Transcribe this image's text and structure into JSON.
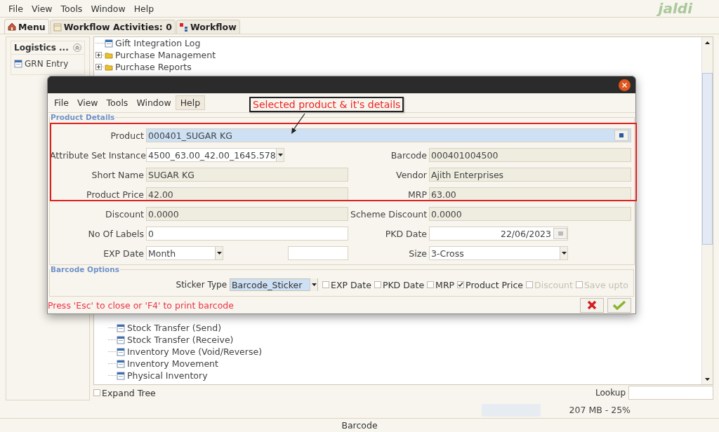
{
  "menu_bar": {
    "items": [
      {
        "label": "File"
      },
      {
        "label": "View"
      },
      {
        "label": "Tools"
      },
      {
        "label": "Window"
      },
      {
        "label": "Help"
      }
    ],
    "logo": "jaldi"
  },
  "tabs": [
    {
      "label": "Menu",
      "kind": "home",
      "selected": true
    },
    {
      "label": "Workflow Activities: 0",
      "kind": "activities",
      "selected": false
    },
    {
      "label": "Workflow",
      "kind": "workflow",
      "selected": false
    }
  ],
  "sidebar": {
    "title": "Logistics ...",
    "items": [
      {
        "label": "GRN Entry"
      }
    ]
  },
  "tree": {
    "top_items": [
      {
        "label": "Gift Integration Log",
        "kind": "leaf"
      },
      {
        "label": "Purchase Management",
        "kind": "folder"
      },
      {
        "label": "Purchase Reports",
        "kind": "folder"
      }
    ],
    "bottom_items": [
      {
        "label": "Stock Transfer (Send)"
      },
      {
        "label": "Stock Transfer (Receive)"
      },
      {
        "label": "Inventory Move (Void/Reverse)"
      },
      {
        "label": "Inventory Movement"
      },
      {
        "label": "Physical Inventory"
      }
    ]
  },
  "expand_tree": {
    "label": "Expand Tree",
    "checked": false
  },
  "lookup": {
    "label": "Lookup"
  },
  "memory": {
    "reading": "207 MB - 25%"
  },
  "status_bar": "Barcode",
  "dialog": {
    "menu": [
      {
        "label": "File",
        "selected": false
      },
      {
        "label": "View",
        "selected": false
      },
      {
        "label": "Tools",
        "selected": false
      },
      {
        "label": "Window",
        "selected": false
      },
      {
        "label": "Help",
        "selected": true
      }
    ],
    "annotation": "Selected product & it's details",
    "product_details": {
      "legend": "Product Details",
      "rows": [
        {
          "label": "Product",
          "field": {
            "kind": "lookup",
            "value": "000401_SUGAR KG",
            "focused": true
          }
        },
        {
          "label": "Attribute Set Instance",
          "field": {
            "kind": "combo",
            "value": "4500_63.00_42.00_1645.578"
          },
          "right_label": "Barcode",
          "right_field": {
            "kind": "readonly",
            "value": "000401004500"
          }
        },
        {
          "label": "Short Name",
          "field": {
            "kind": "readonly",
            "value": "SUGAR KG"
          },
          "right_label": "Vendor",
          "right_field": {
            "kind": "readonly",
            "value": "Ajith Enterprises"
          }
        },
        {
          "label": "Product Price",
          "field": {
            "kind": "readonly",
            "value": "42.00"
          },
          "right_label": "MRP",
          "right_field": {
            "kind": "readonly",
            "value": "63.00"
          }
        },
        {
          "label": "Discount",
          "field": {
            "kind": "readonly",
            "value": "0.0000"
          },
          "right_label": "Scheme Discount",
          "right_field": {
            "kind": "readonly",
            "value": "0.0000"
          }
        },
        {
          "label": "No Of Labels",
          "field": {
            "kind": "text",
            "value": "0"
          },
          "right_label": "PKD Date",
          "right_field": {
            "kind": "date",
            "value": "22/06/2023"
          }
        },
        {
          "label": "EXP Date",
          "field": {
            "kind": "combo",
            "value": "Month"
          },
          "extra_field": {
            "kind": "text"
          },
          "right_label": "Size",
          "right_field": {
            "kind": "combo",
            "value": "3-Cross"
          }
        }
      ]
    },
    "barcode_options": {
      "legend": "Barcode Options",
      "sticker_label": "Sticker Type",
      "sticker_value": "Barcode_Sticker",
      "checkboxes": [
        {
          "label": "EXP Date",
          "checked": false,
          "disabled": false
        },
        {
          "label": "PKD Date",
          "checked": false,
          "disabled": false
        },
        {
          "label": "MRP",
          "checked": false,
          "disabled": false
        },
        {
          "label": "Product Price",
          "checked": true,
          "disabled": false
        },
        {
          "label": "Discount",
          "checked": false,
          "disabled": true
        },
        {
          "label": "Save upto",
          "checked": false,
          "disabled": true
        }
      ]
    },
    "hint": "Press 'Esc' to close or 'F4' to print barcode"
  }
}
